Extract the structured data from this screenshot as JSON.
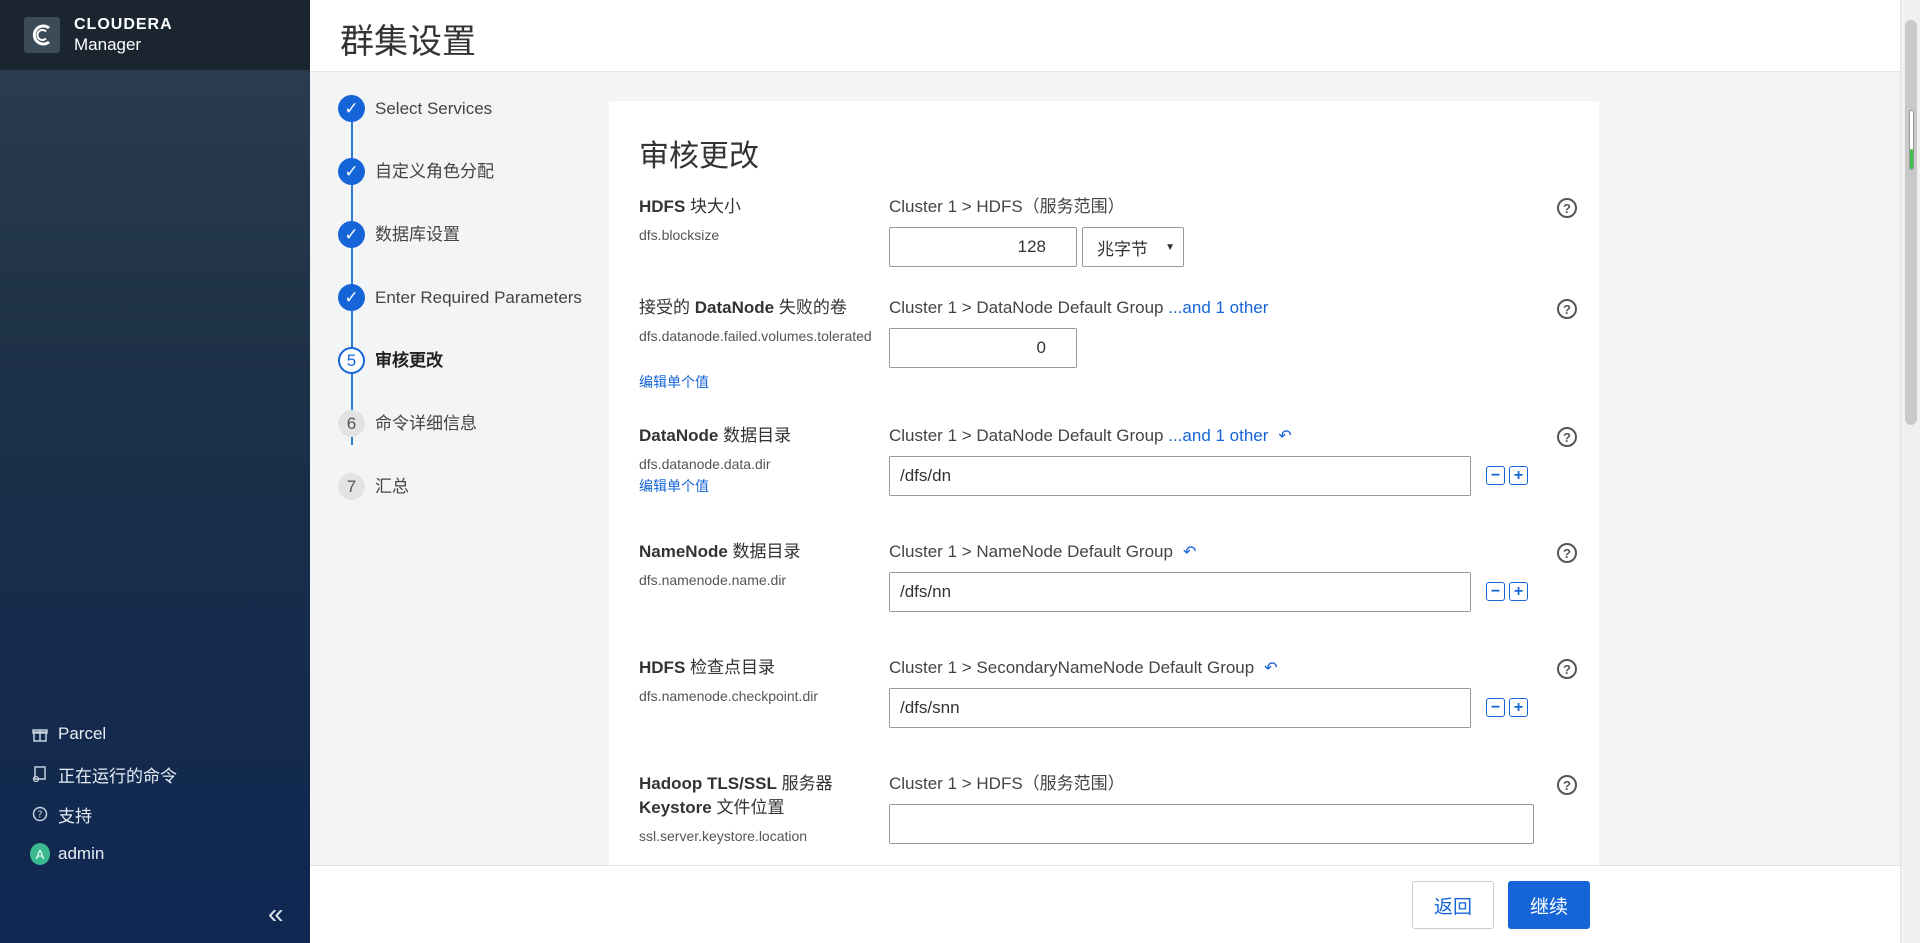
{
  "brand": {
    "line1": "CLOUDERA",
    "line2": "Manager"
  },
  "header": {
    "title": "群集设置"
  },
  "steps": [
    {
      "label": "Select Services",
      "marker": "✓",
      "state": "done"
    },
    {
      "label": "自定义角色分配",
      "marker": "✓",
      "state": "done"
    },
    {
      "label": "数据库设置",
      "marker": "✓",
      "state": "done"
    },
    {
      "label": "Enter Required Parameters",
      "marker": "✓",
      "state": "done"
    },
    {
      "label": "审核更改",
      "marker": "5",
      "state": "current"
    },
    {
      "label": "命令详细信息",
      "marker": "6",
      "state": "todo"
    },
    {
      "label": "汇总",
      "marker": "7",
      "state": "todo"
    }
  ],
  "sidebar": {
    "items": [
      {
        "label": "Parcel",
        "icon": "gift-icon"
      },
      {
        "label": "正在运行的命令",
        "icon": "commands-icon"
      },
      {
        "label": "支持",
        "icon": "help-circle-icon"
      },
      {
        "label": "admin",
        "icon": "avatar",
        "avatar_letter": "A"
      }
    ],
    "collapse_glyph": "«"
  },
  "main": {
    "title": "审核更改",
    "params": [
      {
        "name_bold": "HDFS",
        "name_rest": " 块大小",
        "key": "dfs.blocksize",
        "scope": "Cluster 1 > HDFS（服务范围）",
        "value": "128",
        "unit": "兆字节"
      },
      {
        "name_pre": "接受的 ",
        "name_bold": "DataNode",
        "name_rest": " 失败的卷",
        "key": "dfs.datanode.failed.volumes.tolerated",
        "edit": "编辑单个值",
        "scope": "Cluster 1 > DataNode Default Group ",
        "scope_link": "...and 1 other",
        "value": "0"
      },
      {
        "name_bold": "DataNode",
        "name_rest": " 数据目录",
        "key": "dfs.datanode.data.dir",
        "edit": "编辑单个值",
        "scope": "Cluster 1 > DataNode Default Group ",
        "scope_link": "...and 1 other",
        "value": "/dfs/dn"
      },
      {
        "name_bold": "NameNode",
        "name_rest": " 数据目录",
        "key": "dfs.namenode.name.dir",
        "scope": "Cluster 1 > NameNode Default Group",
        "value": "/dfs/nn"
      },
      {
        "name_bold": "HDFS",
        "name_rest": " 检查点目录",
        "key": "dfs.namenode.checkpoint.dir",
        "scope": "Cluster 1 > SecondaryNameNode Default Group",
        "value": "/dfs/snn"
      },
      {
        "name_bold": "Hadoop TLS/SSL",
        "name_rest": " 服务器",
        "name_line2_bold": "Keystore",
        "name_line2_rest": " 文件位置",
        "key": "ssl.server.keystore.location",
        "scope": "Cluster 1 > HDFS（服务范围）",
        "value": ""
      }
    ]
  },
  "footer": {
    "back_label": "返回",
    "continue_label": "继续"
  },
  "colors": {
    "accent": "#1565d8",
    "sidebar_top": "#2d3f4f",
    "sidebar_bottom": "#0f2752"
  }
}
